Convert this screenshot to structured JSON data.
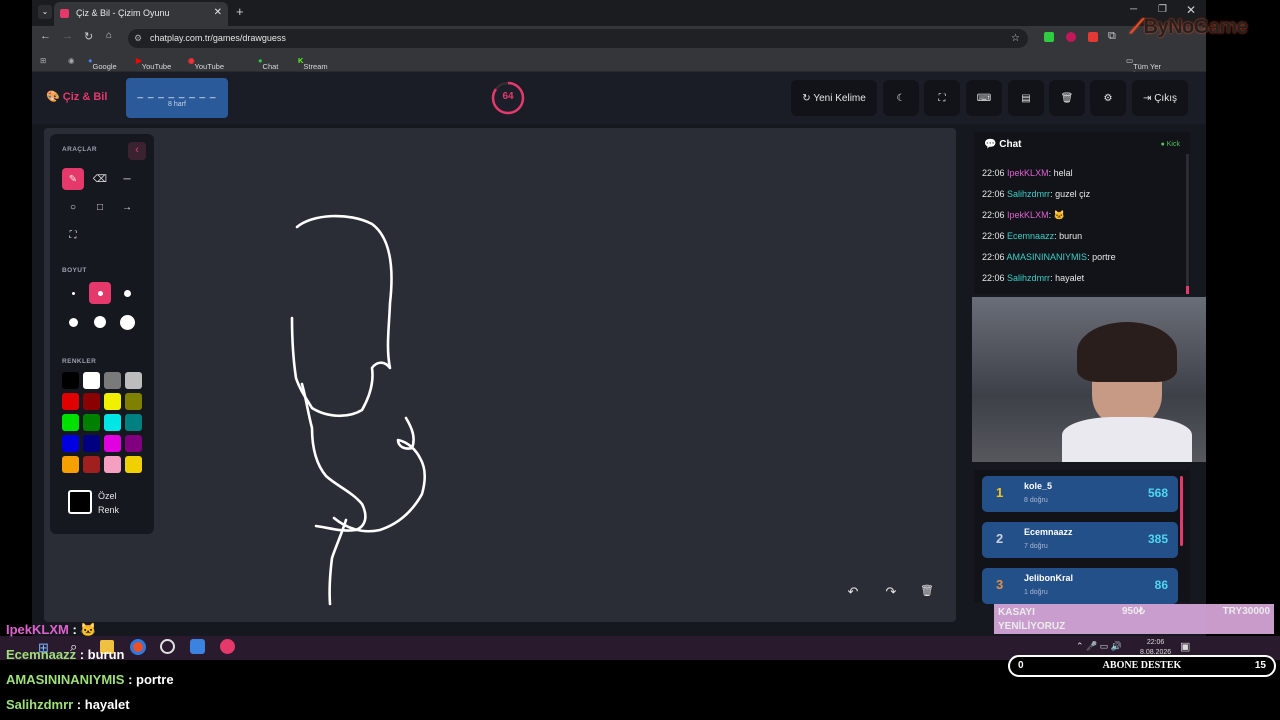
{
  "browser": {
    "tab_title": "Çiz & Bil - Çizim Oyunu",
    "url": "chatplay.com.tr/games/drawguess",
    "bookmarks": [
      "Google",
      "YouTube",
      "YouTube Music",
      "Chat",
      "Stream - Kick Dashb..."
    ],
    "all_bookmarks": "Tüm Yer İşaretleri"
  },
  "app": {
    "logo": "Çiz & Bil",
    "word_mask": "_ _ _ _ _ _ _ _",
    "word_len": "8 harf",
    "timer": "64",
    "timer_fraction": 0.85,
    "new_word": "Yeni Kelime",
    "exit": "Çıkış"
  },
  "tools": {
    "section_tools": "ARAÇLAR",
    "section_size": "BOYUT",
    "section_colors": "RENKLER",
    "custom_color": "Özel\nRenk",
    "colors": [
      "#000000",
      "#ffffff",
      "#7a7a7a",
      "#bdbdbd",
      "#e00000",
      "#8b0000",
      "#f0f000",
      "#808000",
      "#00e000",
      "#008000",
      "#00e5e5",
      "#008080",
      "#0000e0",
      "#000080",
      "#e000e0",
      "#800080",
      "#f5a000",
      "#a02020",
      "#f5a0c0",
      "#f0d000"
    ]
  },
  "chat": {
    "title": "Chat",
    "platform": "Kick",
    "messages": [
      {
        "time": "22:06",
        "user": "IpekKLXM",
        "color": "#e060d0",
        "text": "helal"
      },
      {
        "time": "22:06",
        "user": "Salihzdmrr",
        "color": "#3ad0c8",
        "text": "guzel çiz"
      },
      {
        "time": "22:06",
        "user": "IpekKLXM",
        "color": "#e060d0",
        "text": "🐱"
      },
      {
        "time": "22:06",
        "user": "Ecemnaazz",
        "color": "#3ad0c8",
        "text": "burun"
      },
      {
        "time": "22:06",
        "user": "AMASININANIYMIS",
        "color": "#3ad0c8",
        "text": "portre"
      },
      {
        "time": "22:06",
        "user": "Salihzdmrr",
        "color": "#3ad0c8",
        "text": "hayalet"
      }
    ]
  },
  "leaderboard": [
    {
      "rank": "1",
      "name": "kole_5",
      "sub": "8 doğru",
      "score": "568"
    },
    {
      "rank": "2",
      "name": "Ecemnaazz",
      "sub": "7 doğru",
      "score": "385"
    },
    {
      "rank": "3",
      "name": "JelibonKral",
      "sub": "1 doğru",
      "score": "86"
    }
  ],
  "overlay": {
    "logo": "ByNoGame",
    "chat": [
      {
        "user": "IpekKLXM",
        "color": "#e060d0",
        "text": "🐱"
      },
      {
        "user": "Ecemnaazz",
        "color": "#9ee07a",
        "text": "burun"
      },
      {
        "user": "AMASININANIYMIS",
        "color": "#9ee07a",
        "text": "portre"
      },
      {
        "user": "Salihzdmrr",
        "color": "#9ee07a",
        "text": "hayalet"
      }
    ],
    "banner_left": "KASAYI\nYENİLİYORUZ",
    "banner_mid": "950₺",
    "banner_right": "TRY30000",
    "goal_left": "0",
    "goal_title": "ABONE DESTEK",
    "goal_right": "15",
    "clock_time": "22:06",
    "clock_date": "8.08.2026"
  }
}
